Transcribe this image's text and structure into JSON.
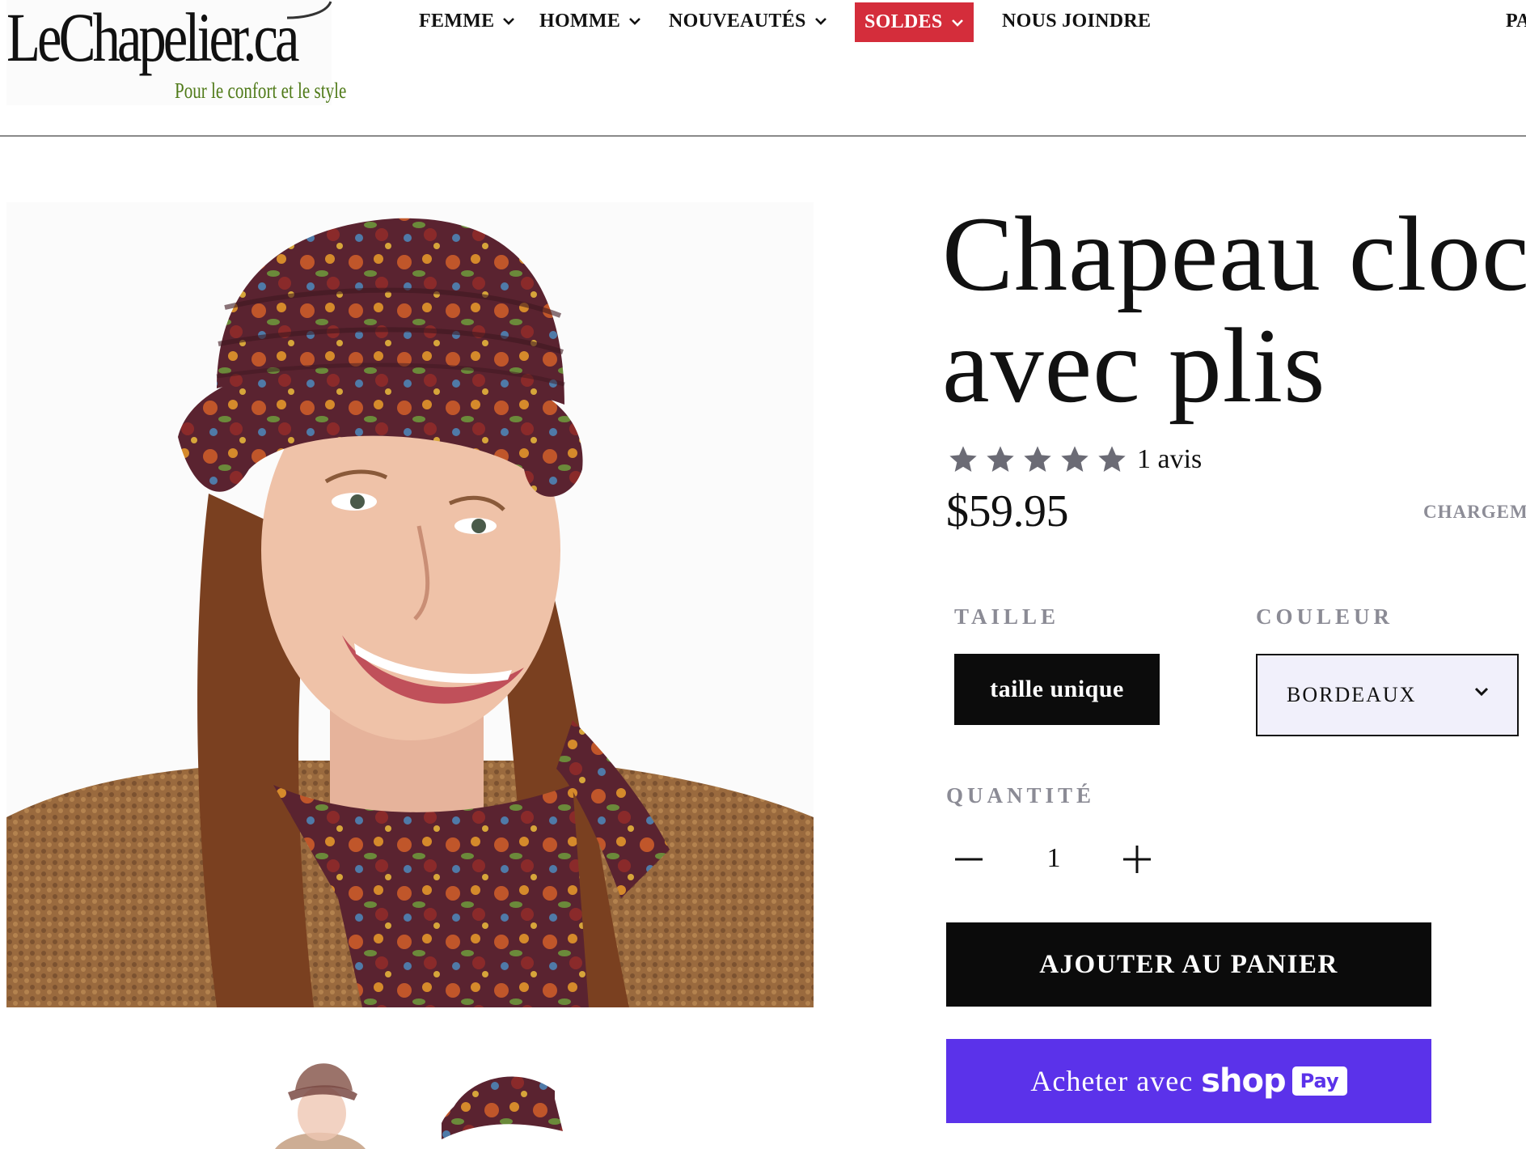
{
  "logo": {
    "brand": "LeChapelier.ca",
    "tagline": "Pour le confort et le style"
  },
  "nav": {
    "items": [
      {
        "label": "FEMME"
      },
      {
        "label": "HOMME"
      },
      {
        "label": "NOUVEAUTÉS"
      },
      {
        "label": "SOLDES",
        "highlighted": true
      },
      {
        "label": "NOUS JOINDRE"
      }
    ],
    "overflow_label": "PA",
    "sale_color": "#d42d3b"
  },
  "product": {
    "title_line1": "Chapeau cloc",
    "title_line2": "avec plis",
    "rating": {
      "stars": 5,
      "max": 5,
      "review_count_label": "1 avis"
    },
    "price": "$59.95",
    "shipping_note": "CHARGEM",
    "options": {
      "size_label": "TAILLE",
      "size_value": "taille unique",
      "color_label": "COULEUR",
      "color_value": "BORDEAUX"
    },
    "quantity": {
      "label": "QUANTITÉ",
      "value": "1"
    },
    "add_to_cart_label": "AJOUTER AU PANIER",
    "shop_pay": {
      "label": "Acheter avec",
      "brand": "shop",
      "badge": "Pay"
    }
  },
  "images": {
    "main_alt": "Femme souriante portant un chapeau cloche à motifs floraux bordeaux",
    "thumbnails": [
      "thumb-model",
      "thumb-hat"
    ]
  },
  "colors": {
    "accent_black": "#0b0b0b",
    "shop_pay_purple": "#5b32ea",
    "label_gray": "#8b8b95",
    "select_bg": "#f1f0fb"
  }
}
